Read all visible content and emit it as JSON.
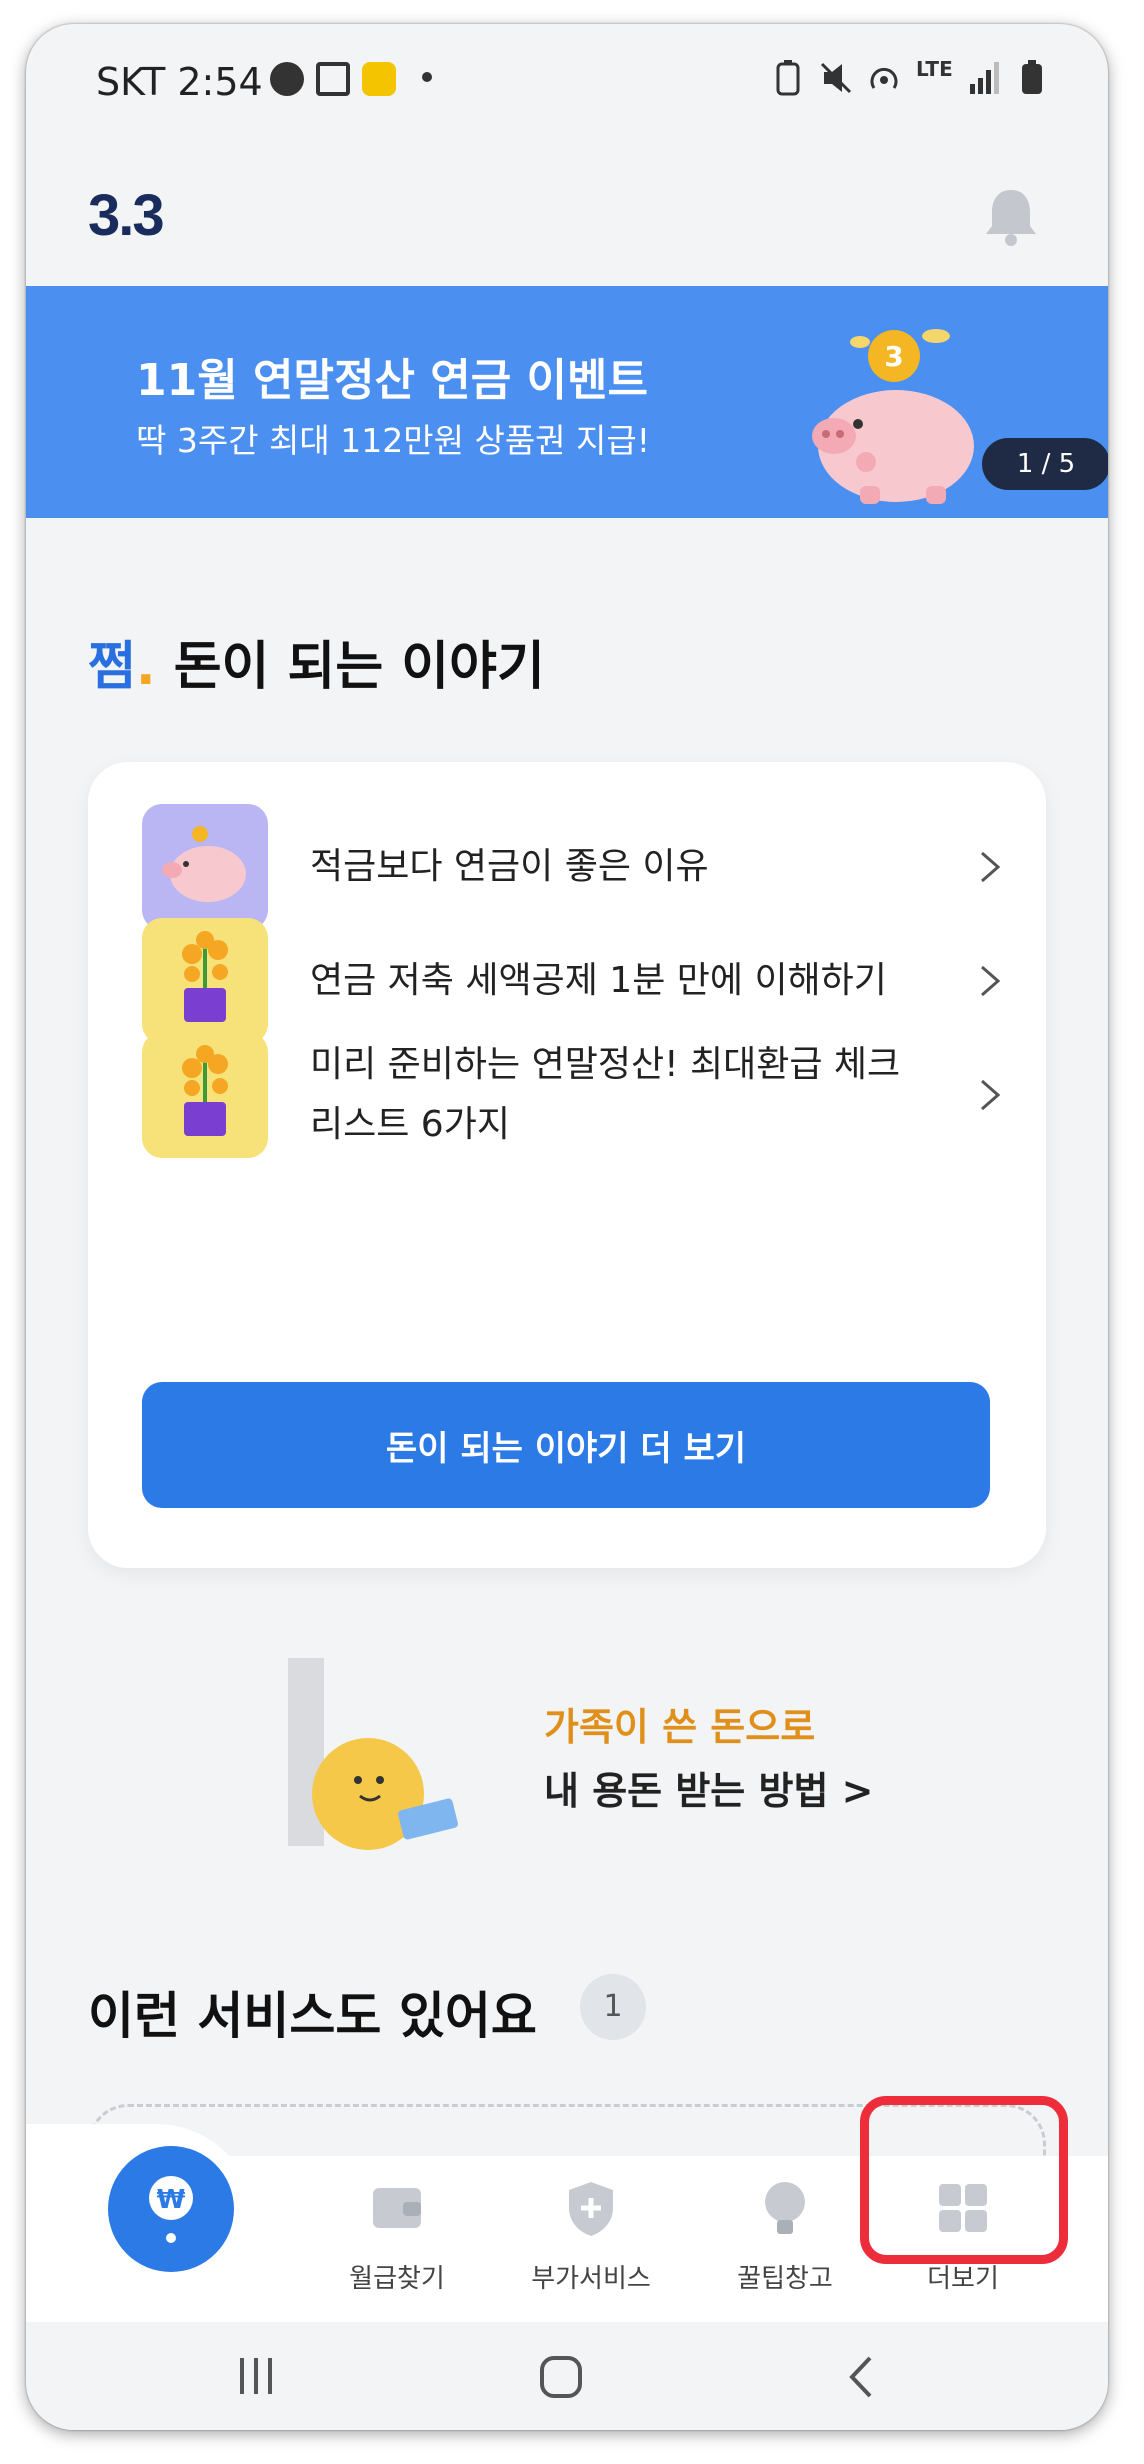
{
  "status_bar": {
    "carrier_time": "SKT 2:54",
    "network": "LTE"
  },
  "header": {
    "logo": "3.3"
  },
  "banner": {
    "title": "11월 연말정산 연금 이벤트",
    "subtitle": "딱 3주간 최대 112만원 상품권 지급!",
    "pager": "1 / 5",
    "background": "#4b8ff0"
  },
  "section": {
    "brand": "쩜",
    "title": "돈이 되는 이야기"
  },
  "stories": [
    {
      "text": "적금보다 연금이 좋은 이유",
      "icon": "piggy-bank-icon",
      "bg": "#b9b6f3"
    },
    {
      "text": "연금 저축 세액공제 1분 만에 이해하기",
      "icon": "money-plant-icon",
      "bg": "#f7e27a"
    },
    {
      "text": "미리 준비하는 연말정산! 최대환급 체크리스트 6가지",
      "icon": "money-plant-icon",
      "bg": "#f7e27a"
    }
  ],
  "more_button": "돈이 되는 이야기 더 보기",
  "promo": {
    "line1": "가족이 쓴 돈으로",
    "line2": "내 용돈 받는 방법 >"
  },
  "services": {
    "title": "이런 서비스도 있어요",
    "count": "1"
  },
  "nav": {
    "items": [
      {
        "label": "월급찾기",
        "icon": "wallet-icon"
      },
      {
        "label": "부가서비스",
        "icon": "shield-plus-icon"
      },
      {
        "label": "꿀팁창고",
        "icon": "lightbulb-icon"
      },
      {
        "label": "더보기",
        "icon": "grid-icon"
      }
    ],
    "accent": "#2b7ae6",
    "highlight_color": "#ee2d3a"
  }
}
